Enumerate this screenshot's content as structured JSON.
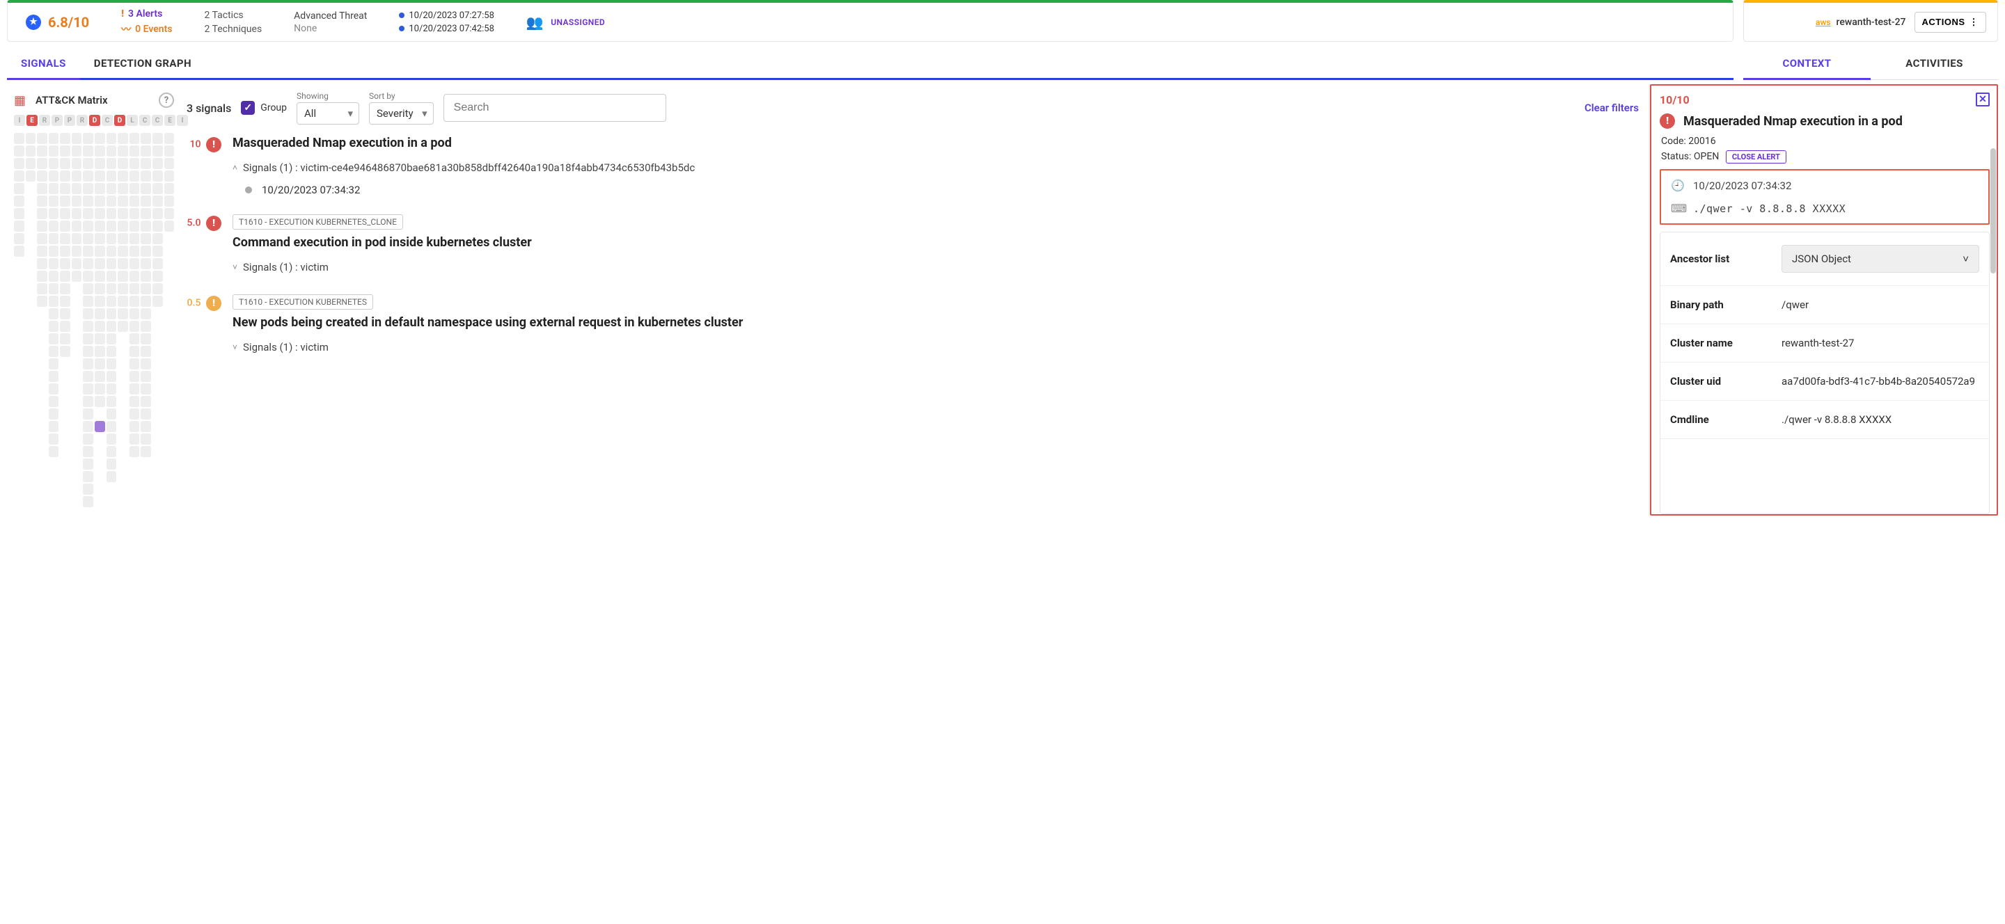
{
  "header": {
    "score": "6.8/10",
    "alerts": "3 Alerts",
    "events": "0 Events",
    "tactics": "2 Tactics",
    "techniques": "2 Techniques",
    "threat_label": "Advanced Threat",
    "threat_value": "None",
    "time_start": "10/20/2023 07:27:58",
    "time_end": "10/20/2023 07:42:58",
    "assigned": "UNASSIGNED",
    "aws_prefix": "aws",
    "resource": "rewanth-test-27",
    "actions": "ACTIONS"
  },
  "tabs_main": {
    "signals": "SIGNALS",
    "graph": "DETECTION GRAPH"
  },
  "tabs_side": {
    "context": "CONTEXT",
    "activities": "ACTIVITIES"
  },
  "matrix": {
    "title": "ATT&CK Matrix",
    "header_chips": [
      "I",
      "E",
      "R",
      "P",
      "P",
      "R",
      "D",
      "C",
      "D",
      "L",
      "C",
      "C",
      "E",
      "I"
    ],
    "red_indices": [
      1,
      6,
      8
    ]
  },
  "toolbar": {
    "count": "3 signals",
    "group": "Group",
    "showing_label": "Showing",
    "showing_value": "All",
    "sort_label": "Sort by",
    "sort_value": "Severity",
    "search_placeholder": "Search",
    "clear": "Clear filters"
  },
  "signals": [
    {
      "score": "10",
      "sev": "red",
      "tag": null,
      "title": "Masqueraded Nmap execution in a pod",
      "sub": "Signals (1) : victim-ce4e946486870bae681a30b858dbff42640a190a18f4abb4734c6530fb43b5dc",
      "expanded": true,
      "timeline": "10/20/2023 07:34:32"
    },
    {
      "score": "5.0",
      "sev": "red",
      "tag": "T1610 - EXECUTION KUBERNETES_CLONE",
      "title": "Command execution in pod inside kubernetes cluster",
      "sub": "Signals (1) : victim",
      "expanded": false
    },
    {
      "score": "0.5",
      "sev": "orange",
      "tag": "T1610 - EXECUTION KUBERNETES",
      "title": "New pods being created in default namespace using external request in kubernetes cluster",
      "sub": "Signals (1) : victim",
      "expanded": false
    }
  ],
  "detail": {
    "score": "10/10",
    "title": "Masqueraded Nmap execution in a pod",
    "code_label": "Code:",
    "code": "20016",
    "status_label": "Status:",
    "status": "OPEN",
    "close_alert": "CLOSE ALERT",
    "evidence": {
      "time": "10/20/2023 07:34:32",
      "cmd": "./qwer -v 8.8.8.8 XXXXX"
    },
    "props": [
      {
        "key": "Ancestor list",
        "type": "json",
        "val": "JSON Object"
      },
      {
        "key": "Binary path",
        "type": "text",
        "val": "/qwer"
      },
      {
        "key": "Cluster name",
        "type": "text",
        "val": "rewanth-test-27"
      },
      {
        "key": "Cluster uid",
        "type": "text",
        "val": "aa7d00fa-bdf3-41c7-bb4b-8a20540572a9"
      },
      {
        "key": "Cmdline",
        "type": "text",
        "val": "./qwer -v 8.8.8.8 XXXXX"
      }
    ]
  }
}
